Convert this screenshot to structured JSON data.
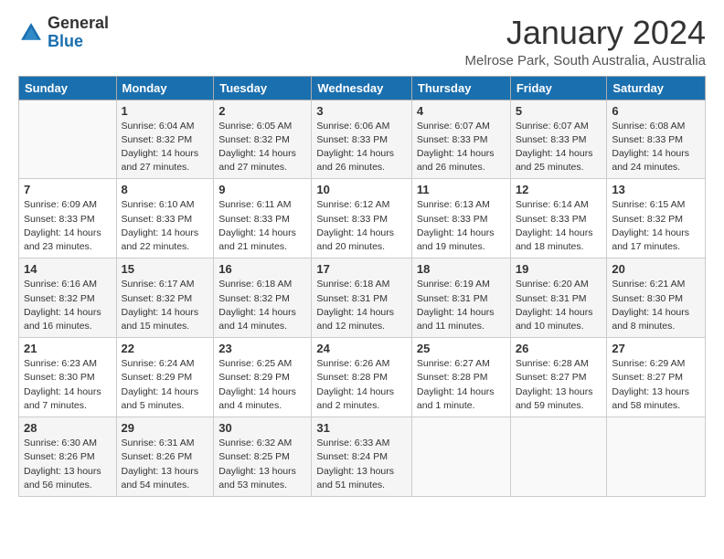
{
  "logo": {
    "general": "General",
    "blue": "Blue"
  },
  "header": {
    "title": "January 2024",
    "subtitle": "Melrose Park, South Australia, Australia"
  },
  "weekdays": [
    "Sunday",
    "Monday",
    "Tuesday",
    "Wednesday",
    "Thursday",
    "Friday",
    "Saturday"
  ],
  "weeks": [
    [
      {
        "day": "",
        "info": ""
      },
      {
        "day": "1",
        "info": "Sunrise: 6:04 AM\nSunset: 8:32 PM\nDaylight: 14 hours\nand 27 minutes."
      },
      {
        "day": "2",
        "info": "Sunrise: 6:05 AM\nSunset: 8:32 PM\nDaylight: 14 hours\nand 27 minutes."
      },
      {
        "day": "3",
        "info": "Sunrise: 6:06 AM\nSunset: 8:33 PM\nDaylight: 14 hours\nand 26 minutes."
      },
      {
        "day": "4",
        "info": "Sunrise: 6:07 AM\nSunset: 8:33 PM\nDaylight: 14 hours\nand 26 minutes."
      },
      {
        "day": "5",
        "info": "Sunrise: 6:07 AM\nSunset: 8:33 PM\nDaylight: 14 hours\nand 25 minutes."
      },
      {
        "day": "6",
        "info": "Sunrise: 6:08 AM\nSunset: 8:33 PM\nDaylight: 14 hours\nand 24 minutes."
      }
    ],
    [
      {
        "day": "7",
        "info": "Sunrise: 6:09 AM\nSunset: 8:33 PM\nDaylight: 14 hours\nand 23 minutes."
      },
      {
        "day": "8",
        "info": "Sunrise: 6:10 AM\nSunset: 8:33 PM\nDaylight: 14 hours\nand 22 minutes."
      },
      {
        "day": "9",
        "info": "Sunrise: 6:11 AM\nSunset: 8:33 PM\nDaylight: 14 hours\nand 21 minutes."
      },
      {
        "day": "10",
        "info": "Sunrise: 6:12 AM\nSunset: 8:33 PM\nDaylight: 14 hours\nand 20 minutes."
      },
      {
        "day": "11",
        "info": "Sunrise: 6:13 AM\nSunset: 8:33 PM\nDaylight: 14 hours\nand 19 minutes."
      },
      {
        "day": "12",
        "info": "Sunrise: 6:14 AM\nSunset: 8:33 PM\nDaylight: 14 hours\nand 18 minutes."
      },
      {
        "day": "13",
        "info": "Sunrise: 6:15 AM\nSunset: 8:32 PM\nDaylight: 14 hours\nand 17 minutes."
      }
    ],
    [
      {
        "day": "14",
        "info": "Sunrise: 6:16 AM\nSunset: 8:32 PM\nDaylight: 14 hours\nand 16 minutes."
      },
      {
        "day": "15",
        "info": "Sunrise: 6:17 AM\nSunset: 8:32 PM\nDaylight: 14 hours\nand 15 minutes."
      },
      {
        "day": "16",
        "info": "Sunrise: 6:18 AM\nSunset: 8:32 PM\nDaylight: 14 hours\nand 14 minutes."
      },
      {
        "day": "17",
        "info": "Sunrise: 6:18 AM\nSunset: 8:31 PM\nDaylight: 14 hours\nand 12 minutes."
      },
      {
        "day": "18",
        "info": "Sunrise: 6:19 AM\nSunset: 8:31 PM\nDaylight: 14 hours\nand 11 minutes."
      },
      {
        "day": "19",
        "info": "Sunrise: 6:20 AM\nSunset: 8:31 PM\nDaylight: 14 hours\nand 10 minutes."
      },
      {
        "day": "20",
        "info": "Sunrise: 6:21 AM\nSunset: 8:30 PM\nDaylight: 14 hours\nand 8 minutes."
      }
    ],
    [
      {
        "day": "21",
        "info": "Sunrise: 6:23 AM\nSunset: 8:30 PM\nDaylight: 14 hours\nand 7 minutes."
      },
      {
        "day": "22",
        "info": "Sunrise: 6:24 AM\nSunset: 8:29 PM\nDaylight: 14 hours\nand 5 minutes."
      },
      {
        "day": "23",
        "info": "Sunrise: 6:25 AM\nSunset: 8:29 PM\nDaylight: 14 hours\nand 4 minutes."
      },
      {
        "day": "24",
        "info": "Sunrise: 6:26 AM\nSunset: 8:28 PM\nDaylight: 14 hours\nand 2 minutes."
      },
      {
        "day": "25",
        "info": "Sunrise: 6:27 AM\nSunset: 8:28 PM\nDaylight: 14 hours\nand 1 minute."
      },
      {
        "day": "26",
        "info": "Sunrise: 6:28 AM\nSunset: 8:27 PM\nDaylight: 13 hours\nand 59 minutes."
      },
      {
        "day": "27",
        "info": "Sunrise: 6:29 AM\nSunset: 8:27 PM\nDaylight: 13 hours\nand 58 minutes."
      }
    ],
    [
      {
        "day": "28",
        "info": "Sunrise: 6:30 AM\nSunset: 8:26 PM\nDaylight: 13 hours\nand 56 minutes."
      },
      {
        "day": "29",
        "info": "Sunrise: 6:31 AM\nSunset: 8:26 PM\nDaylight: 13 hours\nand 54 minutes."
      },
      {
        "day": "30",
        "info": "Sunrise: 6:32 AM\nSunset: 8:25 PM\nDaylight: 13 hours\nand 53 minutes."
      },
      {
        "day": "31",
        "info": "Sunrise: 6:33 AM\nSunset: 8:24 PM\nDaylight: 13 hours\nand 51 minutes."
      },
      {
        "day": "",
        "info": ""
      },
      {
        "day": "",
        "info": ""
      },
      {
        "day": "",
        "info": ""
      }
    ]
  ]
}
